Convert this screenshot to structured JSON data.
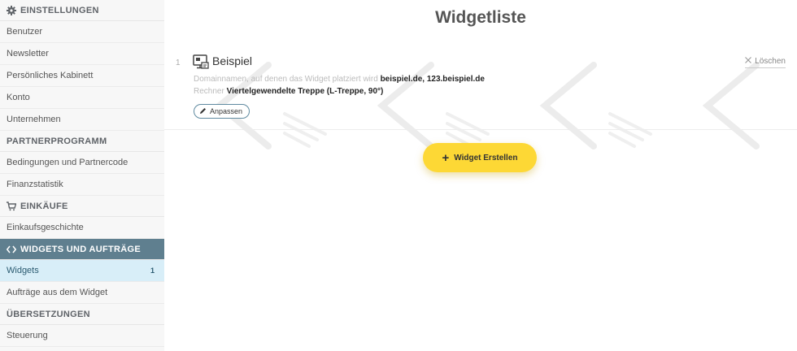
{
  "sidebar": {
    "sections": [
      {
        "title": "EINSTELLUNGEN",
        "icon": "gear-icon",
        "items": [
          {
            "label": "Benutzer"
          },
          {
            "label": "Newsletter"
          },
          {
            "label": "Persönliches Kabinett"
          },
          {
            "label": "Konto"
          },
          {
            "label": "Unternehmen"
          }
        ]
      },
      {
        "title": "PARTNERPROGRAMM",
        "items": [
          {
            "label": "Bedingungen und Partnercode"
          },
          {
            "label": "Finanzstatistik"
          }
        ]
      },
      {
        "title": "EINKÄUFE",
        "icon": "cart-icon",
        "items": [
          {
            "label": "Einkaufsgeschichte"
          }
        ]
      },
      {
        "title": "WIDGETS UND AUFTRÄGE",
        "icon": "code-icon",
        "items": [
          {
            "label": "Widgets",
            "count": "1"
          },
          {
            "label": "Aufträge aus dem Widget"
          }
        ]
      },
      {
        "title": "ÜBERSETZUNGEN",
        "items": [
          {
            "label": "Steuerung"
          }
        ]
      }
    ]
  },
  "main": {
    "title": "Widgetliste",
    "widgets": [
      {
        "index": "1",
        "icon": "monitor-widget-icon",
        "name": "Beispiel",
        "delete_label": "Löschen",
        "domains_label": "Domainnamen, auf denen das Widget platziert wird",
        "domains_value": "beispiel.de, 123.beispiel.de",
        "calculator_label": "Rechner",
        "calculator_value": "Viertelgewendelte Treppe (L-Treppe, 90°)",
        "adjust_label": "Anpassen"
      }
    ],
    "create_button_label": "Widget Erstellen"
  },
  "colors": {
    "accent_yellow": "#fdd835",
    "sidebar_active_header": "#5f7f8f",
    "sidebar_active_item": "#d8eef8"
  }
}
